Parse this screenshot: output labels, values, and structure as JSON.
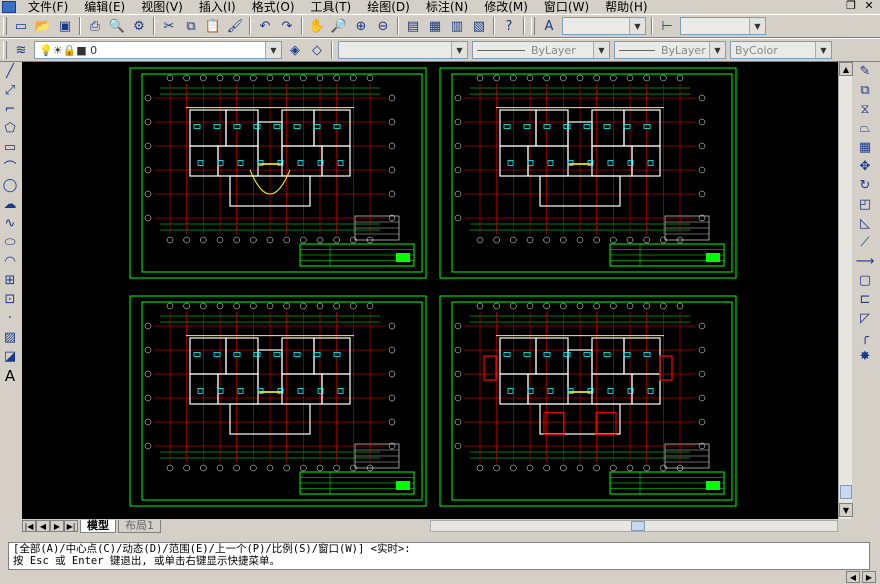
{
  "menu": {
    "items": [
      "文件(F)",
      "编辑(E)",
      "视图(V)",
      "插入(I)",
      "格式(O)",
      "工具(T)",
      "绘图(D)",
      "标注(N)",
      "修改(M)",
      "窗口(W)",
      "帮助(H)"
    ]
  },
  "layer_combo": {
    "value": "0"
  },
  "linetype_combo": {
    "value": "ByLayer"
  },
  "lineweight_combo": {
    "value": "ByLayer"
  },
  "color_combo": {
    "value": "ByColor"
  },
  "tabs": {
    "model": "模型",
    "layout1": "布局1"
  },
  "command": {
    "line1": "[全部(A)/中心点(C)/动态(D)/范围(E)/上一个(P)/比例(S)/窗口(W)] <实时>:",
    "line2": "按 Esc 或 Enter 键退出, 或单击右键显示快捷菜单。"
  },
  "colors": {
    "canvas_bg": "#000000",
    "frame": "#00ff00",
    "walls": "#ffff00",
    "axis": "#ff0000",
    "fixtures": "#00ffff",
    "dims": "#ffffff"
  }
}
